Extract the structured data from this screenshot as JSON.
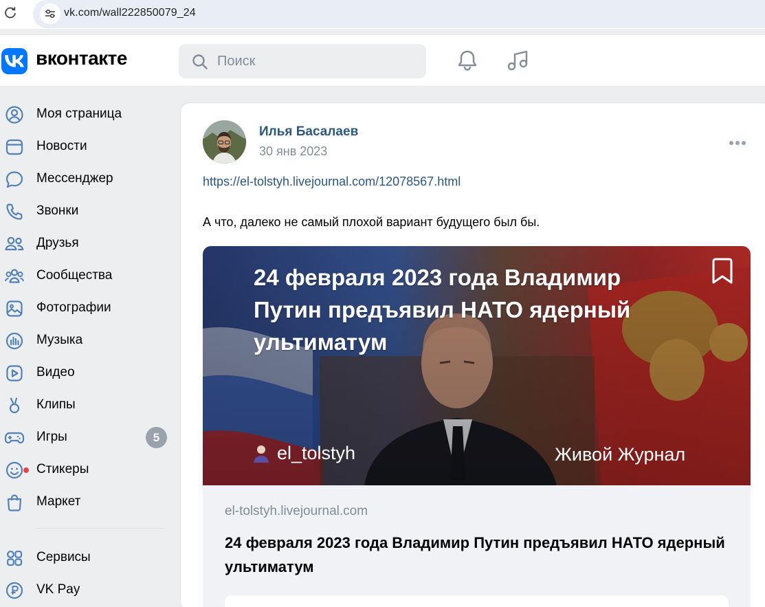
{
  "browser": {
    "url": "vk.com/wall222850079_24"
  },
  "header": {
    "logo_text": "вконтакте",
    "search_placeholder": "Поиск",
    "icons": [
      "bell-icon",
      "music-icon"
    ]
  },
  "sidebar": {
    "items": [
      {
        "label": "Моя страница",
        "icon": "user-circle-icon"
      },
      {
        "label": "Новости",
        "icon": "news-icon"
      },
      {
        "label": "Мессенджер",
        "icon": "message-icon"
      },
      {
        "label": "Звонки",
        "icon": "phone-icon"
      },
      {
        "label": "Друзья",
        "icon": "friends-icon"
      },
      {
        "label": "Сообщества",
        "icon": "communities-icon"
      },
      {
        "label": "Фотографии",
        "icon": "photo-icon"
      },
      {
        "label": "Музыка",
        "icon": "music-bars-icon"
      },
      {
        "label": "Видео",
        "icon": "video-icon"
      },
      {
        "label": "Клипы",
        "icon": "clips-icon"
      },
      {
        "label": "Игры",
        "icon": "gamepad-icon",
        "badge": "5"
      },
      {
        "label": "Стикеры",
        "icon": "sticker-icon"
      },
      {
        "label": "Маркет",
        "icon": "market-bag-icon"
      }
    ],
    "secondary": [
      {
        "label": "Сервисы",
        "icon": "services-grid-icon"
      },
      {
        "label": "VK Pay",
        "icon": "vkpay-icon"
      }
    ]
  },
  "post": {
    "author": "Илья Басалаев",
    "date": "30 янв 2023",
    "link": "https://el-tolstyh.livejournal.com/12078567.html",
    "text": "А что, далеко не самый плохой вариант будущего был бы.",
    "preview": {
      "overlay_title": "24 февраля 2023 года Владимир Путин предъявил НАТО ядерный ультиматум",
      "overlay_author": "el_tolstyh",
      "overlay_platform": "Живой Журнал",
      "domain": "el-tolstyh.livejournal.com",
      "heading": "24 февраля 2023 года Владимир Путин предъявил НАТО ядерный ультиматум"
    }
  },
  "colors": {
    "vk_blue": "#0077ff",
    "link": "#2a5885",
    "muted": "#818c99",
    "badge": "#99a2ad",
    "page_bg": "#edeef0"
  }
}
